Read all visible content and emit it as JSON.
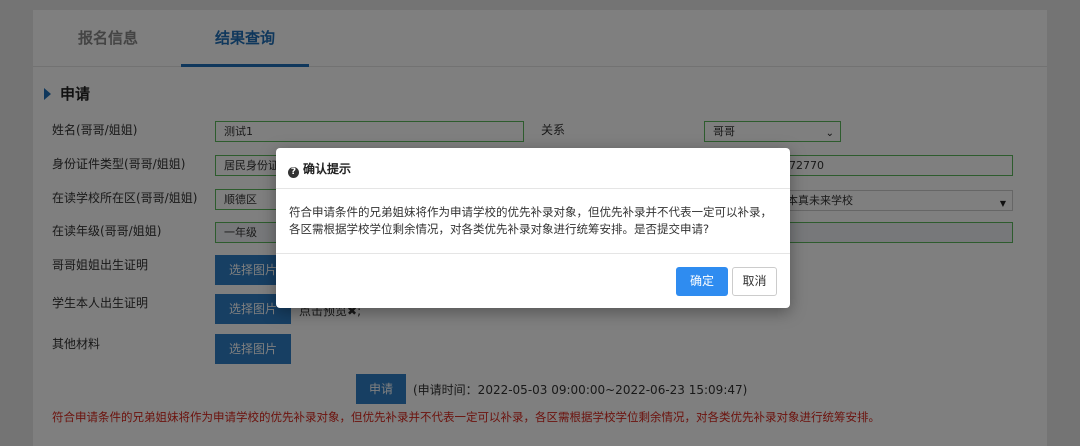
{
  "tabs": [
    "报名信息",
    "结果查询"
  ],
  "section_title": "申请",
  "form": {
    "name_label": "姓名(哥哥/姐姐)",
    "name_value": "测试1",
    "relation_label": "关系",
    "relation_value": "哥哥",
    "id_type_label": "身份证件类型(哥哥/姐姐)",
    "id_type_value": "居民身份证",
    "id_number_value": "72770",
    "district_label": "在读学校所在区(哥哥/姐姐)",
    "district_value": "顺德区",
    "school_value": "本真未来学校",
    "grade_label": "在读年级(哥哥/姐姐)",
    "grade_value": "一年级",
    "sibling_birth_label": "哥哥姐姐出生证明",
    "student_birth_label": "学生本人出生证明",
    "other_label": "其他材料",
    "choose_image": "选择图片",
    "preview_text": "点击预览",
    "preview_close": "✖",
    "preview_suffix": ";",
    "submit_label": "申请",
    "submit_time": "(申请时间：2022-05-03 09:00:00~2022-06-23 15:09:47)",
    "warning": "符合申请条件的兄弟姐妹将作为申请学校的优先补录对象，但优先补录并不代表一定可以补录，各区需根据学校学位剩余情况，对各类优先补录对象进行统筹安排。"
  },
  "dialog": {
    "icon": "question-circle-icon",
    "title": "确认提示",
    "message": "符合申请条件的兄弟姐妹将作为申请学校的优先补录对象，但优先补录并不代表一定可以补录，各区需根据学校学位剩余情况，对各类优先补录对象进行统筹安排。是否提交申请?",
    "ok": "确定",
    "cancel": "取消"
  }
}
